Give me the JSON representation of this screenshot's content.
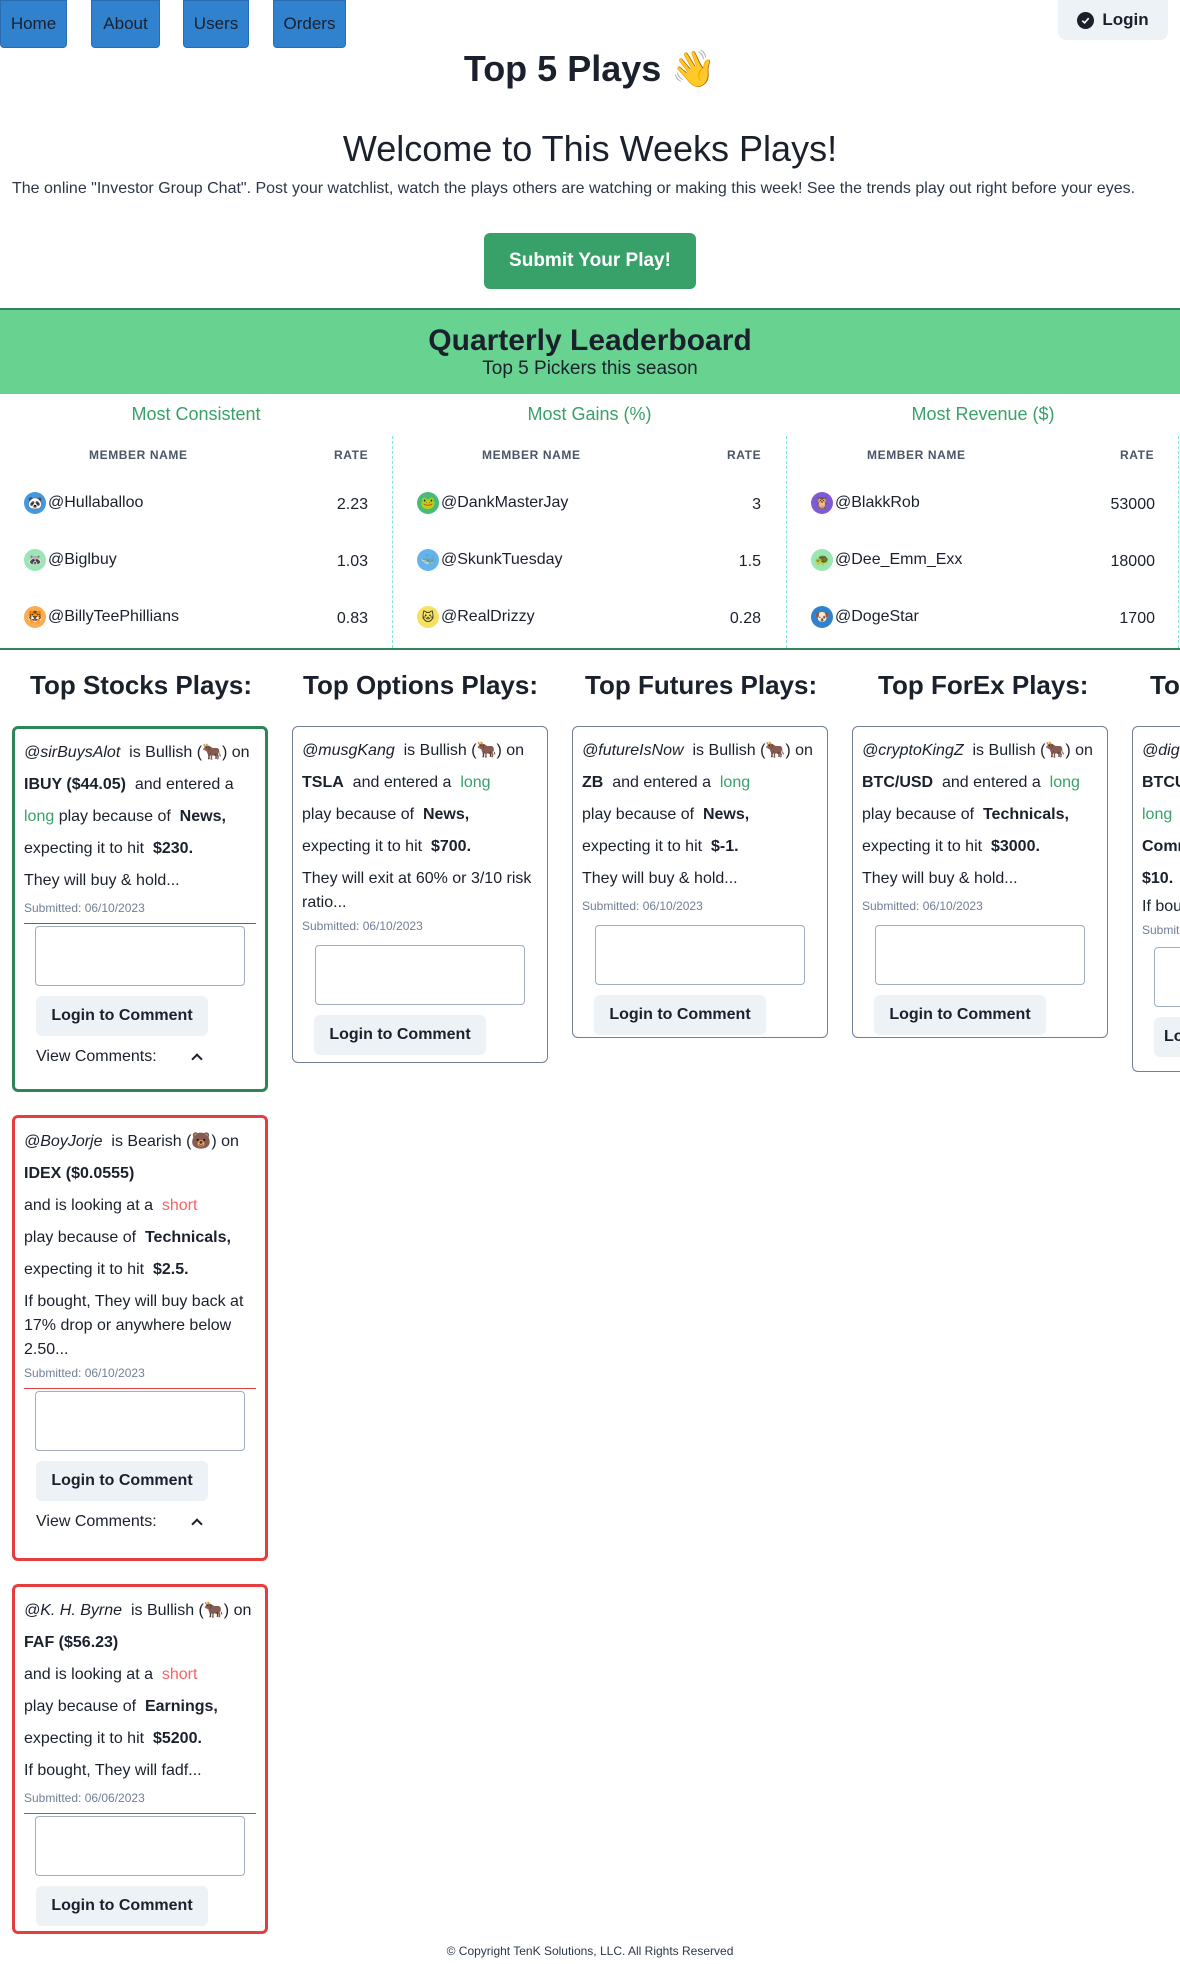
{
  "nav": {
    "items": [
      "Home",
      "About",
      "Users",
      "Orders"
    ],
    "login": "Login"
  },
  "header": {
    "title": "Top 5 Plays 👋",
    "welcome": "Welcome to This Weeks Plays!",
    "intro": "The online \"Investor Group Chat\". Post your watchlist, watch the plays others are watching or making this week! See the trends play out right before your eyes.",
    "submit": "Submit Your Play!"
  },
  "leaderboard": {
    "title": "Quarterly Leaderboard",
    "subtitle": "Top 5 Pickers this season",
    "name_header": "MEMBER NAME",
    "rate_header": "RATE",
    "columns": [
      {
        "title": "Most Consistent",
        "rows": [
          {
            "name": "@Hullaballoo",
            "rate": "2.23",
            "avatar_color": "#4299e1",
            "avatar": "🐼"
          },
          {
            "name": "@Biglbuy",
            "rate": "1.03",
            "avatar_color": "#9ae6b4",
            "avatar": "🦝"
          },
          {
            "name": "@BillyTeePhillians",
            "rate": "0.83",
            "avatar_color": "#f6ad55",
            "avatar": "🐯"
          }
        ]
      },
      {
        "title": "Most Gains (%)",
        "rows": [
          {
            "name": "@DankMasterJay",
            "rate": "3",
            "avatar_color": "#48bb78",
            "avatar": "🐸"
          },
          {
            "name": "@SkunkTuesday",
            "rate": "1.5",
            "avatar_color": "#63b3ed",
            "avatar": "🐳"
          },
          {
            "name": "@RealDrizzy",
            "rate": "0.28",
            "avatar_color": "#f6e05e",
            "avatar": "🐱"
          }
        ]
      },
      {
        "title": "Most Revenue ($)",
        "rows": [
          {
            "name": "@BlakkRob",
            "rate": "53000",
            "avatar_color": "#805ad5",
            "avatar": "🦉"
          },
          {
            "name": "@Dee_Emm_Exx",
            "rate": "18000",
            "avatar_color": "#9ae6b4",
            "avatar": "🐢"
          },
          {
            "name": "@DogeStar",
            "rate": "1700",
            "avatar_color": "#3182ce",
            "avatar": "🐶"
          }
        ]
      }
    ]
  },
  "plays": {
    "columns": [
      {
        "title": "Top Stocks Plays:",
        "cards": [
          {
            "user": "@sirBuysAlot",
            "sentiment": "Bullish (🐂)",
            "ticker": "IBUY ($44.05)",
            "action_pre": "and entered a",
            "position": "long",
            "reason": "News,",
            "target": "$230.",
            "note": "They will buy & hold...",
            "submitted": "Submitted: 06/10/2023",
            "view_comments": "View Comments:"
          },
          {
            "user": "@BoyJorje",
            "sentiment": "Bearish (🐻)",
            "ticker": "IDEX ($0.0555)",
            "action_pre": "and is looking at a",
            "position": "short",
            "reason": "Technicals,",
            "target": "$2.5.",
            "note": "If bought, They will buy back at 17% drop or anywhere below 2.50...",
            "submitted": "Submitted: 06/10/2023",
            "view_comments": "View Comments:"
          },
          {
            "user": "@K. H. Byrne",
            "sentiment": "Bullish (🐂)",
            "ticker": "FAF ($56.23)",
            "action_pre": "and is looking at a",
            "position": "short",
            "reason": "Earnings,",
            "target": "$5200.",
            "note": "If bought, They will fadf...",
            "submitted": "Submitted: 06/06/2023"
          }
        ]
      },
      {
        "title": "Top Options Plays:",
        "cards": [
          {
            "user": "@musgKang",
            "sentiment": "Bullish (🐂)",
            "ticker": "TSLA",
            "action_pre": "and entered a",
            "position": "long",
            "reason": "News,",
            "target": "$700.",
            "note": "They will exit at 60% or 3/10 risk ratio...",
            "submitted": "Submitted: 06/10/2023"
          }
        ]
      },
      {
        "title": "Top Futures Plays:",
        "cards": [
          {
            "user": "@futureIsNow",
            "sentiment": "Bullish (🐂)",
            "ticker": "ZB",
            "action_pre": "and entered a",
            "position": "long",
            "reason": "News,",
            "target": "$-1.",
            "note": "They will buy & hold...",
            "submitted": "Submitted: 06/10/2023"
          }
        ]
      },
      {
        "title": "Top ForEx Plays:",
        "cards": [
          {
            "user": "@cryptoKingZ",
            "sentiment": "Bullish (🐂)",
            "ticker": "BTC/USD",
            "action_pre": "and entered a",
            "position": "long",
            "reason": "Technicals,",
            "target": "$3000.",
            "note": "They will buy & hold...",
            "submitted": "Submitted: 06/10/2023"
          }
        ]
      },
      {
        "title": "To",
        "partial": {
          "user": "@dig",
          "ticker": "BTCU",
          "position": "long",
          "reason": "Comm",
          "target": "$10.",
          "note": "If bou",
          "submitted": "Submit",
          "login": "Lo"
        }
      }
    ],
    "is_label": "is",
    "on_label": "on",
    "because_label": "play because of",
    "expect_label": "expecting it to hit",
    "comment_login": "Login to Comment"
  },
  "footer": "© Copyright TenK Solutions, LLC. All Rights Reserved"
}
